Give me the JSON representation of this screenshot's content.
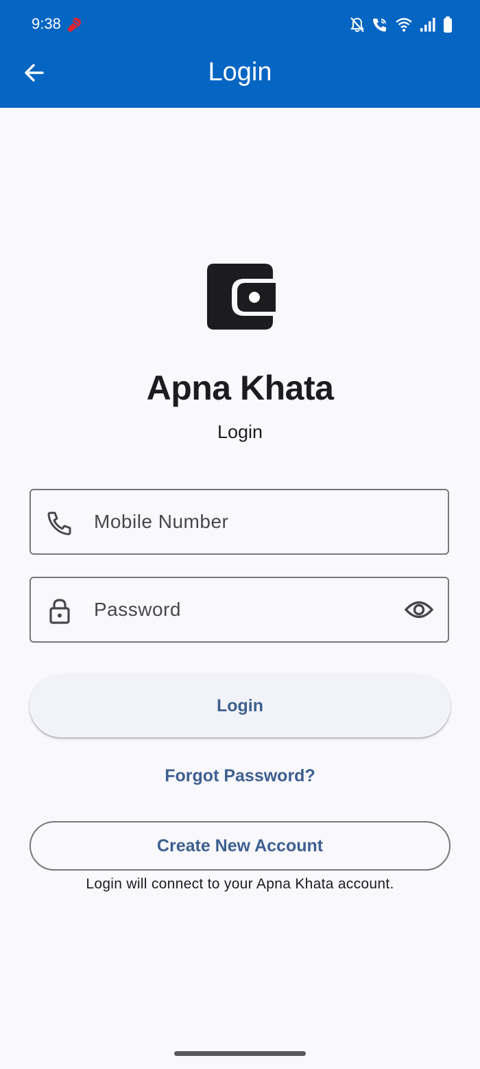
{
  "status_bar": {
    "time": "9:38",
    "icons": [
      "carrier-icon",
      "mute-icon",
      "wifi-call-icon",
      "wifi-icon",
      "signal-icon",
      "battery-icon"
    ]
  },
  "app_bar": {
    "title": "Login",
    "back_icon": "arrow-left-icon"
  },
  "brand": {
    "logo_icon": "wallet-icon",
    "name": "Apna Khata",
    "subtitle": "Login"
  },
  "form": {
    "mobile": {
      "placeholder": "Mobile Number",
      "value": "",
      "icon": "phone-icon"
    },
    "password": {
      "placeholder": "Password",
      "value": "",
      "icon": "lock-icon",
      "toggle_icon": "eye-icon"
    },
    "login_label": "Login",
    "forgot_label": "Forgot Password?",
    "create_account_label": "Create New Account",
    "helper_text": "Login will connect to your Apna Khata account."
  },
  "colors": {
    "app_bar": "#0565c2",
    "background": "#f8f8fd",
    "accent_text": "#3d5f8f",
    "outline": "#77767c"
  }
}
